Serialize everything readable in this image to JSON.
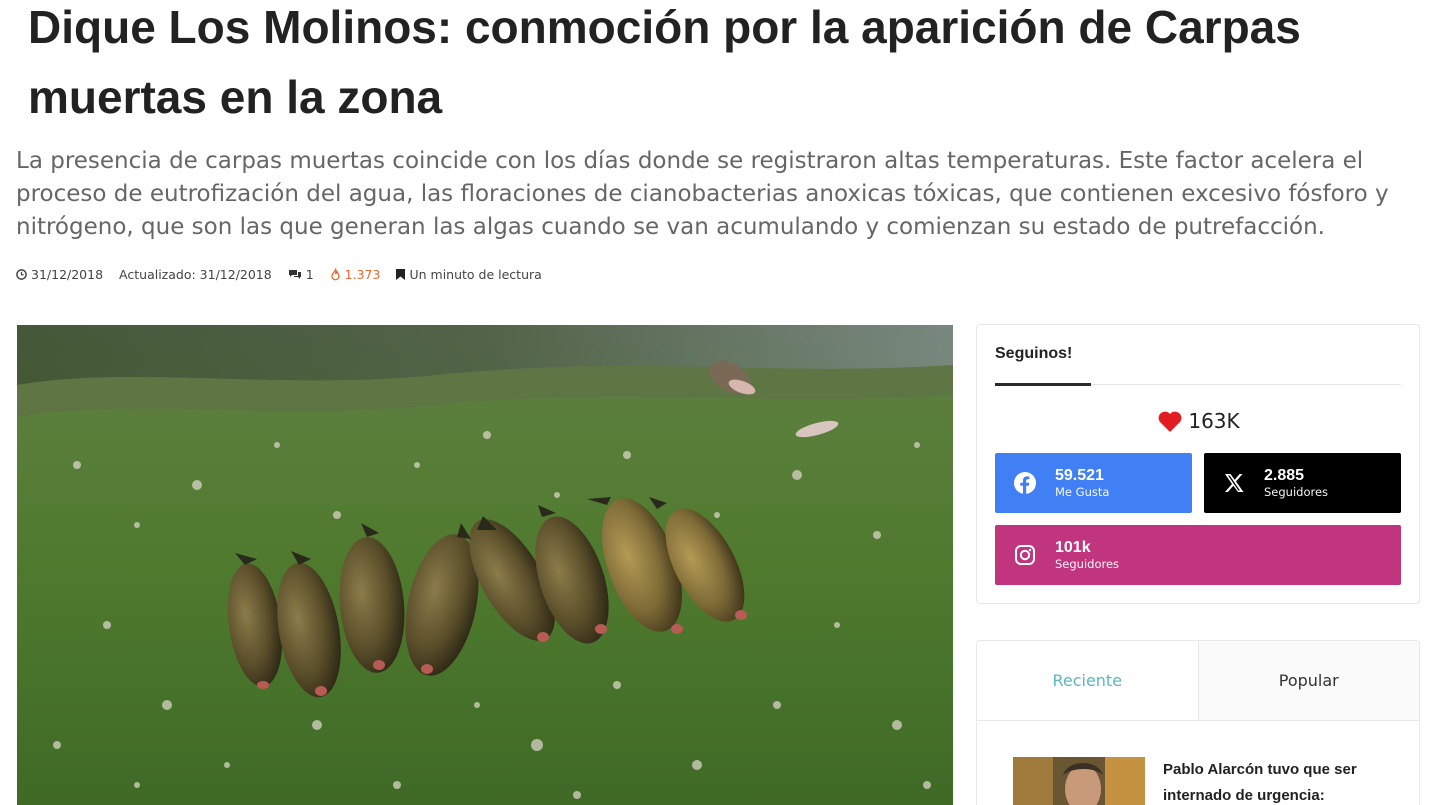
{
  "article": {
    "title": "Dique Los Molinos: conmoción por la aparición de Carpas muertas en la zona",
    "subtitle": "La presencia de carpas muertas coincide con los días donde se registraron altas temperaturas. Este factor acelera el proceso de eutrofización del agua, las floraciones de cianobacterias anoxicas tóxicas, que contienen excesivo fósforo y nitrógeno, que son las que generan las algas cuando se van acumulando y comienzan su estado de putrefacción."
  },
  "meta": {
    "date": "31/12/2018",
    "updated": "Actualizado: 31/12/2018",
    "comments": "1",
    "views": "1.373",
    "reading_time": "Un minuto de lectura",
    "hot_color": "#e8692d"
  },
  "follow": {
    "title": "Seguinos!",
    "likes": "163K",
    "facebook": {
      "count": "59.521",
      "label": "Me Gusta",
      "color": "#4080f4",
      "icon": "facebook-icon"
    },
    "x": {
      "count": "2.885",
      "label": "Seguidores",
      "color": "#000000",
      "icon": "x-icon"
    },
    "instagram": {
      "count": "101k",
      "label": "Seguidores",
      "color": "#c1357f",
      "icon": "instagram-icon"
    }
  },
  "tabs": {
    "items": [
      {
        "label": "Reciente"
      },
      {
        "label": "Popular"
      }
    ],
    "active_color": "#5cb7c0",
    "post": {
      "title": "Pablo Alarcón tuvo que ser internado de urgencia:"
    }
  }
}
